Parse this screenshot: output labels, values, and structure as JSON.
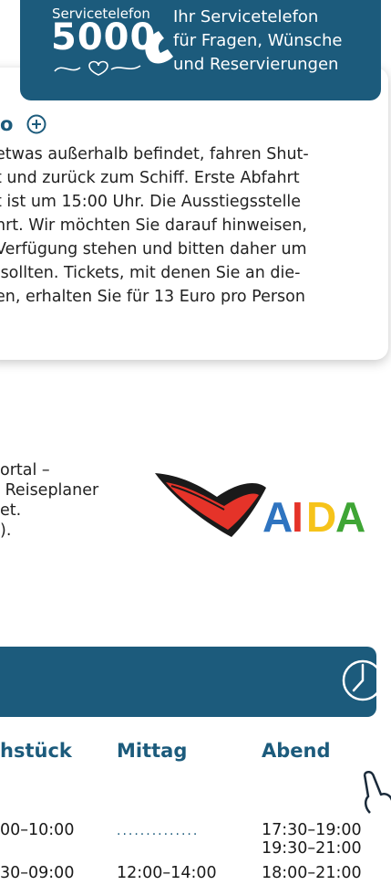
{
  "service": {
    "small_label": "Servicetelefon",
    "number": "5000",
    "text": "Ihr Servicetelefon\nfür Fragen, Wünsche\nund Reservierungen",
    "icon": "phone-icon"
  },
  "card": {
    "heading": "o",
    "paragraph": "etwas außerhalb befindet, fahren Shut-\nt und zurück zum Schiff. Erste Abfahrt\nt ist um 15:00 Uhr. Die Ausstiegsstelle\nhrt. Wir möchten Sie darauf hinweisen,\nVerfügung stehen und bitten daher um\n sollten. Tickets, mit denen Sie an die-\nen, erhalten Sie für 13 Euro pro Person"
  },
  "portal": {
    "text": "ortal –\n Reiseplaner\net.\n)."
  },
  "logo": {
    "text": "AIDA",
    "colors": [
      "#2f74c0",
      "#e53329",
      "#f6c31a",
      "#3fa535"
    ]
  },
  "schedule": {
    "headers": [
      "hstück",
      "Mittag",
      "Abend"
    ],
    "rows": [
      {
        "breakfast": "00–10:00",
        "lunch": "",
        "dinner": "17:30–19:00\n19:30–21:00"
      },
      {
        "breakfast": "30–09:00",
        "lunch": "12:00–14:00",
        "dinner": "18:00–21:00"
      }
    ]
  },
  "colors": {
    "primary": "#1c5b7c"
  }
}
